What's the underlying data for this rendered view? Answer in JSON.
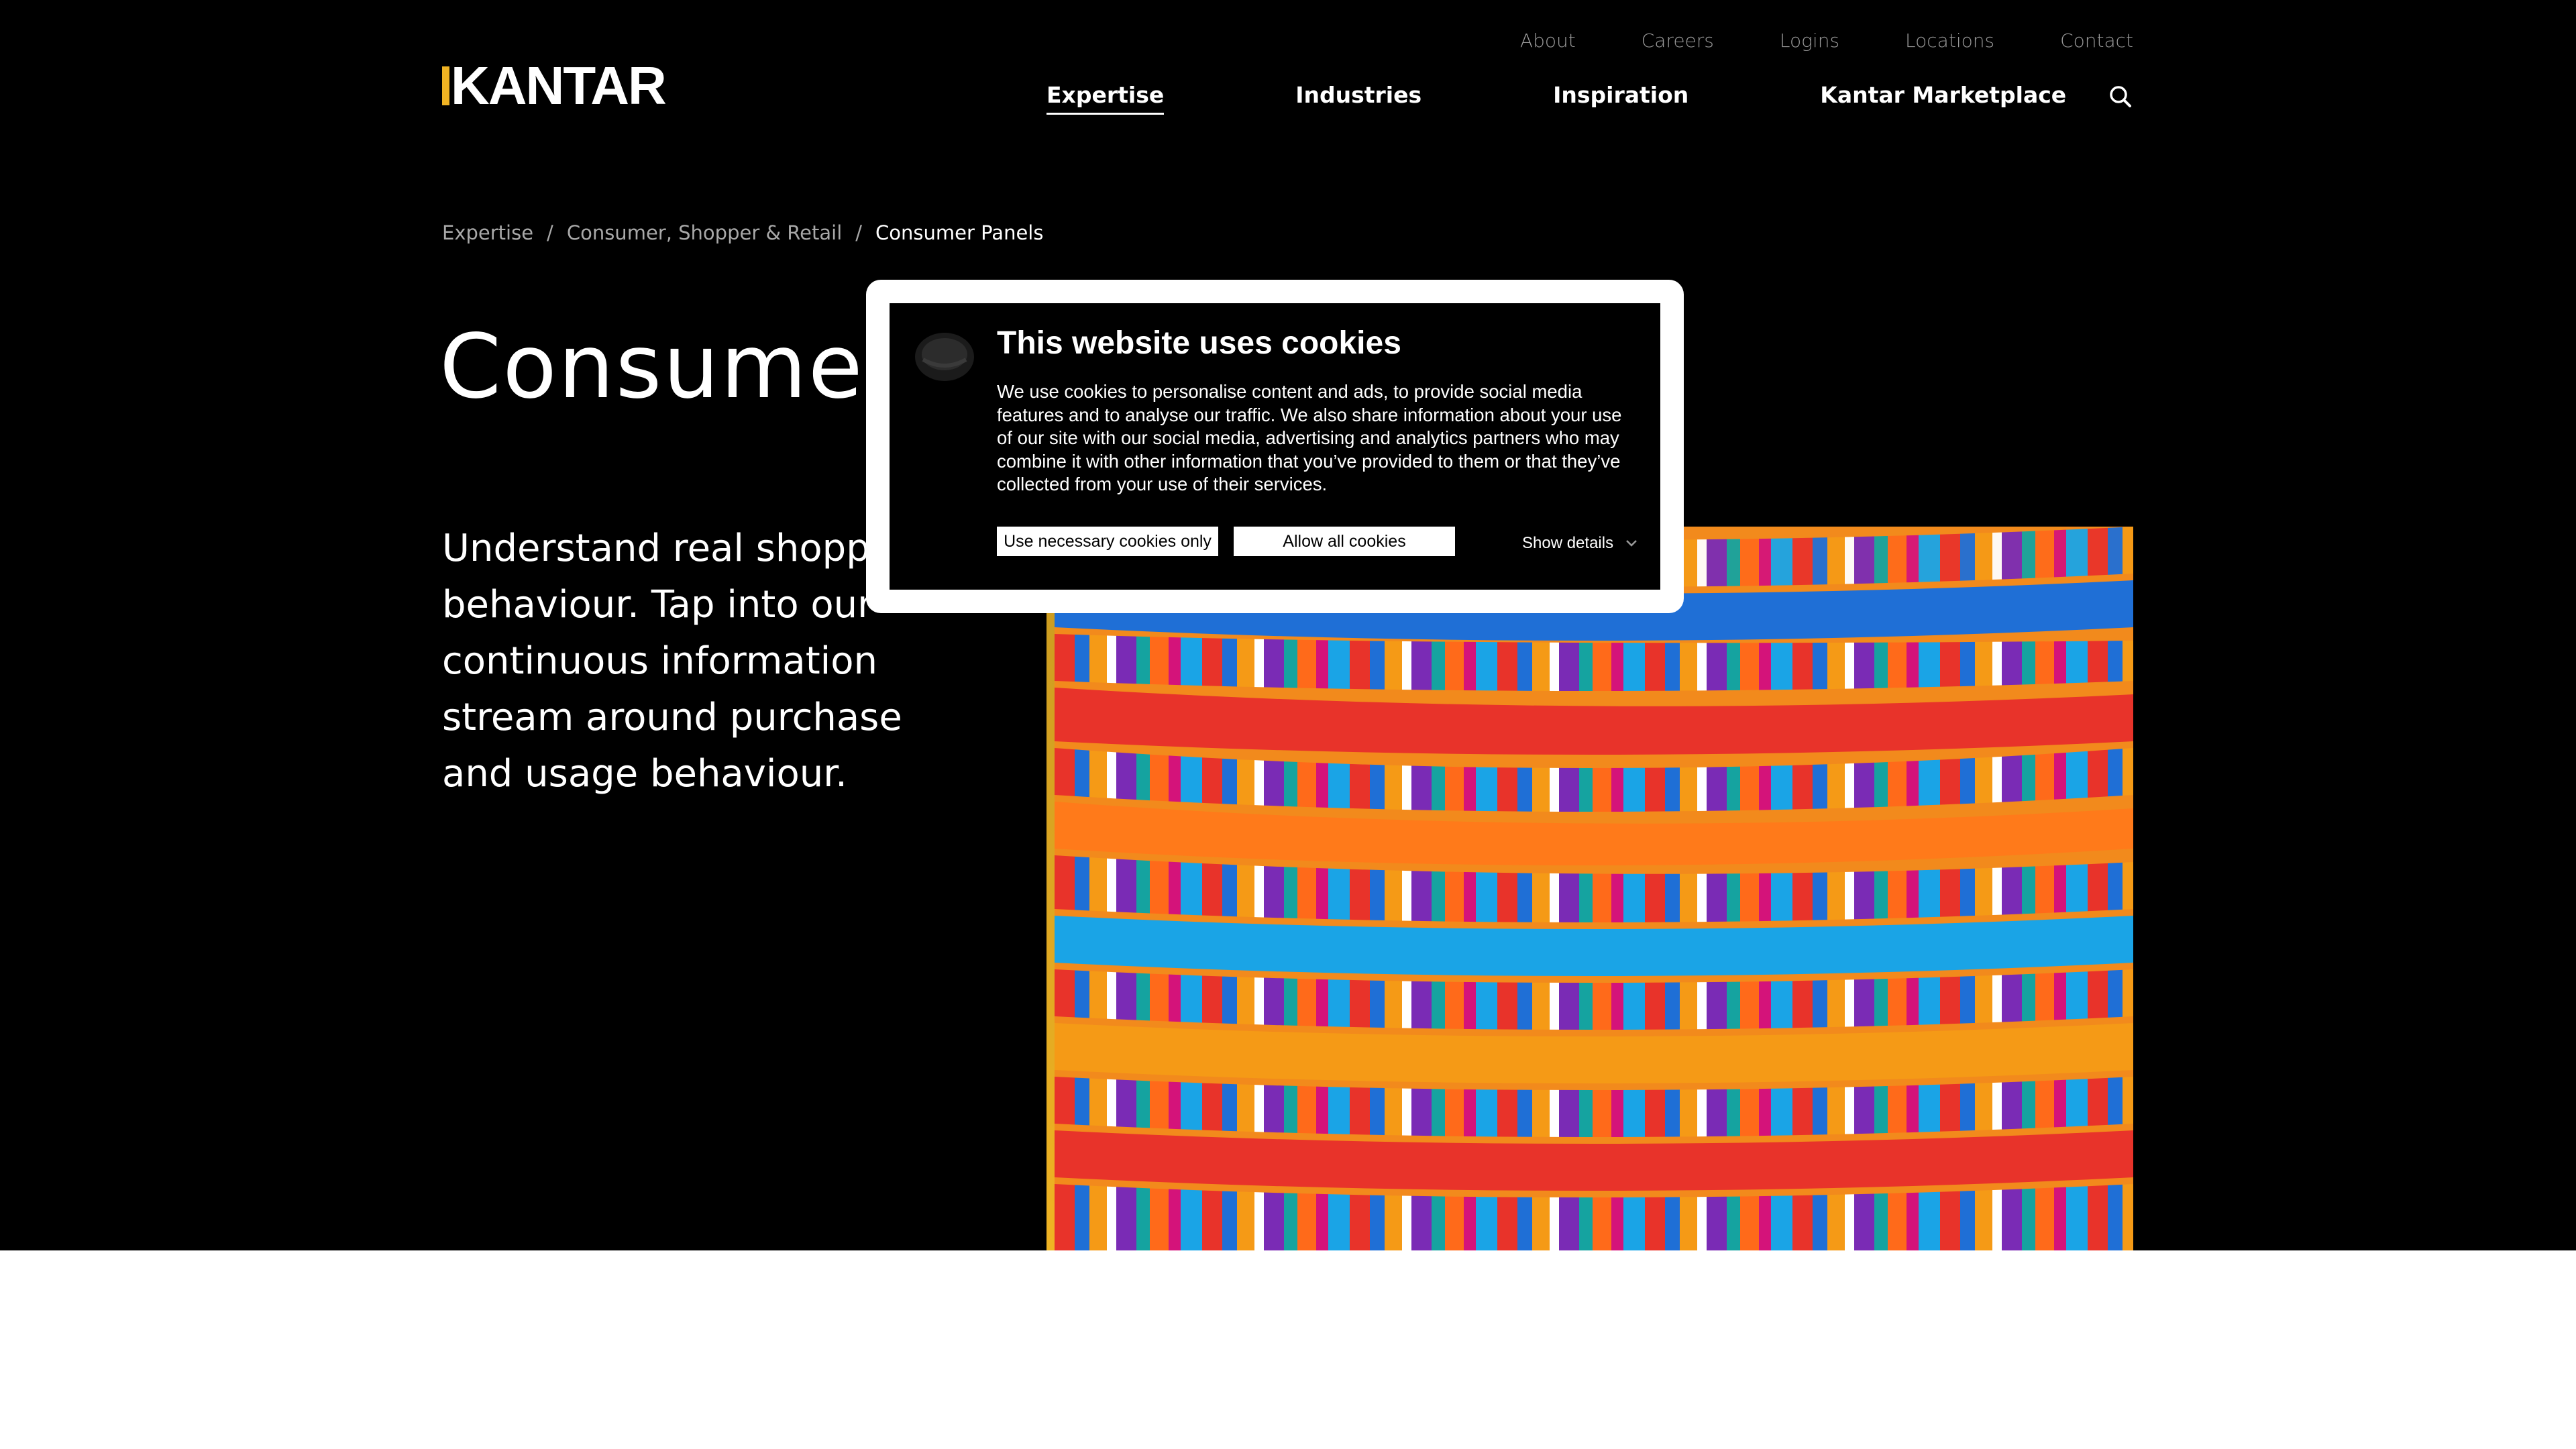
{
  "brand": {
    "logo_text": "KANTAR",
    "accent_color": "#f0b323"
  },
  "utility_nav": [
    "About",
    "Careers",
    "Logins",
    "Locations",
    "Contact"
  ],
  "main_nav": {
    "items": [
      "Expertise",
      "Industries",
      "Inspiration",
      "Kantar Marketplace"
    ],
    "active": "Expertise",
    "search_icon": "search-icon"
  },
  "breadcrumb": {
    "items": [
      "Expertise",
      "Consumer, Shopper & Retail"
    ],
    "separator": "/",
    "current": "Consumer Panels"
  },
  "page": {
    "title": "Consumer Panels",
    "intro": "Understand real shopper behaviour. Tap into our continuous information stream around purchase and usage behaviour."
  },
  "cookie_dialog": {
    "title": "This website uses cookies",
    "body": "We use cookies to personalise content and ads, to provide social media features and to analyse our traffic. We also share information about your use of our site with our social media, advertising and analytics partners who may combine it with other information that you’ve provided to them or that they’ve collected from your use of their services.",
    "necessary_label": "Use necessary cookies only",
    "allow_label": "Allow all cookies",
    "details_label": "Show details",
    "logo_icon": "cookiebot-logo-icon"
  }
}
